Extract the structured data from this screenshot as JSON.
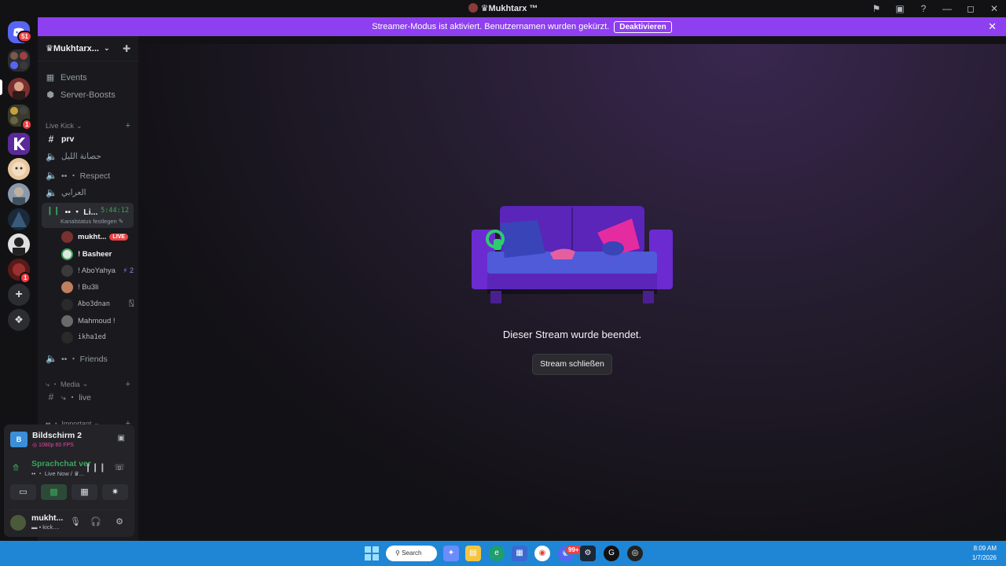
{
  "window": {
    "title": "♛Mukhtarx ™"
  },
  "streamer_banner": {
    "text": "Streamer-Modus ist aktiviert. Benutzernamen wurden gekürzt.",
    "button": "Deaktivieren"
  },
  "servers": {
    "home_badge": "51",
    "badges": [
      "1",
      "1"
    ]
  },
  "guild": {
    "name": "♛Mukhtarx...",
    "nav": [
      {
        "label": "Events"
      },
      {
        "label": "Server-Boosts"
      }
    ],
    "categories": {
      "live_kick": "Live Kick",
      "media": "⤷ ・ Media",
      "important": "•• ・ Important"
    },
    "channels": {
      "prv": "prv",
      "arabic1": "حصانة الليل",
      "respect": "•• ・ Respect",
      "arabic2": "العرابي",
      "friends": "•• ・ Friends",
      "live": "⤷ ・ live"
    },
    "live_channel": {
      "name": "•• ・ Li...",
      "timer": "5:44:12",
      "status": "Kanalstatus festlegen ✎"
    },
    "voice_users": [
      {
        "name": "mukht...",
        "badge": "LIVE"
      },
      {
        "name": "! Basheer"
      },
      {
        "name": "! AboYahya",
        "extra": "⚡ 2"
      },
      {
        "name": "! Bu3li"
      },
      {
        "name": "Abo3dnan",
        "extra": "⍂"
      },
      {
        "name": "Mahmoud !"
      },
      {
        "name": "ikha1ed"
      }
    ]
  },
  "stream_panel": {
    "source": "Bildschirm 2",
    "thumb_letter": "B",
    "quality": "◎ 1080p 60 FPS",
    "voice_status": "Sprachchat ver",
    "voice_channel": "•• ・ Live Now / ♛...",
    "user_name": "mukht...",
    "user_status": "▬ • kick...."
  },
  "main": {
    "ended_text": "Dieser Stream wurde beendet.",
    "close_button": "Stream schließen"
  },
  "taskbar": {
    "search": "Search",
    "time": "8:09 AM",
    "date": "1/7/2026",
    "discord_badge": "99+"
  },
  "colors": {
    "accent": "#8e3ff0",
    "live_green": "#3ba55c",
    "live_red": "#ed4245",
    "taskbar": "#1f86d6"
  }
}
